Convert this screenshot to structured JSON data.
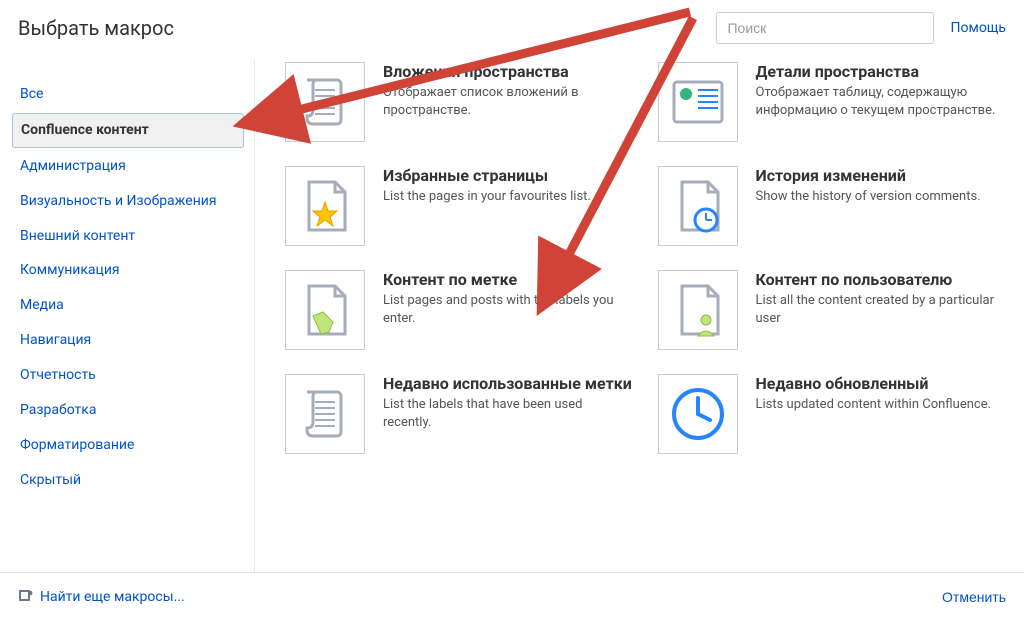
{
  "header": {
    "title": "Выбрать макрос",
    "search_placeholder": "Поиск",
    "help_label": "Помощь"
  },
  "sidebar": {
    "items": [
      {
        "label": "Все",
        "selected": false
      },
      {
        "label": "Confluence контент",
        "selected": true
      },
      {
        "label": "Администрация",
        "selected": false
      },
      {
        "label": "Визуальность и Изображения",
        "selected": false
      },
      {
        "label": "Внешний контент",
        "selected": false
      },
      {
        "label": "Коммуникация",
        "selected": false
      },
      {
        "label": "Медиа",
        "selected": false
      },
      {
        "label": "Навигация",
        "selected": false
      },
      {
        "label": "Отчетность",
        "selected": false
      },
      {
        "label": "Разработка",
        "selected": false
      },
      {
        "label": "Форматирование",
        "selected": false
      },
      {
        "label": "Скрытый",
        "selected": false
      }
    ]
  },
  "macros": [
    {
      "title": "Вложения пространства",
      "desc": "Отображает список вложений в пространстве.",
      "icon": "attachment-list"
    },
    {
      "title": "Детали пространства",
      "desc": "Отображает таблицу, содержащую информацию о текущем пространстве.",
      "icon": "space-details"
    },
    {
      "title": "Избранные страницы",
      "desc": "List the pages in your favourites list.",
      "icon": "favorite-pages"
    },
    {
      "title": "История изменений",
      "desc": "Show the history of version comments.",
      "icon": "change-history"
    },
    {
      "title": "Контент по метке",
      "desc": "List pages and posts with the labels you enter.",
      "icon": "content-by-label"
    },
    {
      "title": "Контент по пользователю",
      "desc": "List all the content created by a particular user",
      "icon": "content-by-user"
    },
    {
      "title": "Недавно использованные метки",
      "desc": "List the labels that have been used recently.",
      "icon": "recent-labels"
    },
    {
      "title": "Недавно обновленный",
      "desc": "Lists updated content within Confluence.",
      "icon": "recently-updated"
    }
  ],
  "footer": {
    "find_more_label": "Найти еще макросы...",
    "cancel_label": "Отменить"
  }
}
